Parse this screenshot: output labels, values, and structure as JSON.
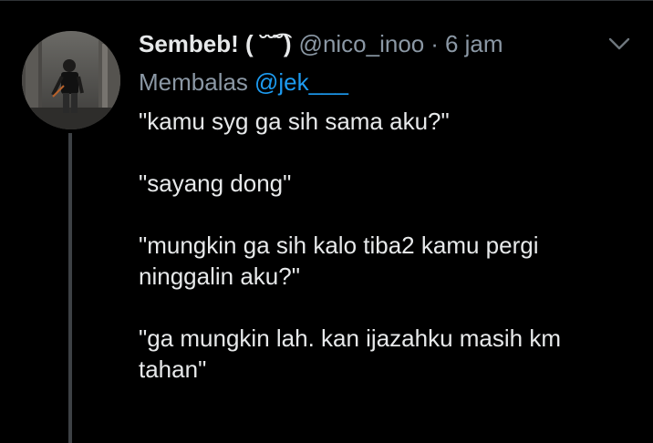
{
  "tweet": {
    "display_name": "Sembeb! ( ˘˘͡˘)",
    "handle": "@nico_inoo",
    "separator": "·",
    "time": "6 jam",
    "reply_prefix": "Membalas",
    "reply_to": "@jek___",
    "lines": [
      "\"kamu syg ga sih sama aku?\"",
      "\"sayang dong\"",
      "\"mungkin ga sih kalo tiba2 kamu pergi ninggalin aku?\"",
      "\"ga mungkin lah. kan ijazahku masih km tahan\""
    ]
  },
  "colors": {
    "background": "#000000",
    "primary_text": "#e7e9ea",
    "secondary_text": "#8b98a5",
    "link": "#1d9bf0",
    "thread_line": "#3d4145"
  },
  "icons": {
    "more": "chevron-down-icon",
    "avatar": "user-avatar"
  }
}
